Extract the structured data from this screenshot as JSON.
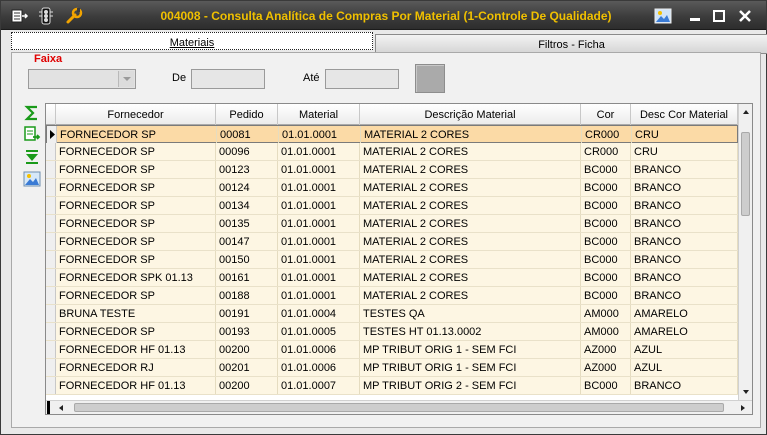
{
  "window": {
    "title": "004008 - Consulta Analítica de Compras Por Material (1-Controle De Qualidade)"
  },
  "tabs": [
    {
      "label": "Materiais",
      "active": true
    },
    {
      "label": "Filtros - Ficha",
      "active": false
    }
  ],
  "filter": {
    "faixa_label": "Faixa",
    "faixa_value": "",
    "de_label": "De",
    "de_value": "",
    "ate_label": "Até",
    "ate_value": ""
  },
  "side_tools": [
    "sum-icon",
    "export-icon",
    "download-icon",
    "image-icon"
  ],
  "grid": {
    "columns": [
      "Fornecedor",
      "Pedido",
      "Material",
      "Descrição Material",
      "Cor",
      "Desc Cor Material"
    ],
    "rows": [
      [
        "FORNECEDOR SP",
        "00081",
        "01.01.0001",
        "MATERIAL 2 CORES",
        "CR000",
        "CRU"
      ],
      [
        "FORNECEDOR SP",
        "00096",
        "01.01.0001",
        "MATERIAL 2 CORES",
        "CR000",
        "CRU"
      ],
      [
        "FORNECEDOR SP",
        "00123",
        "01.01.0001",
        "MATERIAL 2 CORES",
        "BC000",
        "BRANCO"
      ],
      [
        "FORNECEDOR SP",
        "00124",
        "01.01.0001",
        "MATERIAL 2 CORES",
        "BC000",
        "BRANCO"
      ],
      [
        "FORNECEDOR SP",
        "00134",
        "01.01.0001",
        "MATERIAL 2 CORES",
        "BC000",
        "BRANCO"
      ],
      [
        "FORNECEDOR SP",
        "00135",
        "01.01.0001",
        "MATERIAL 2 CORES",
        "BC000",
        "BRANCO"
      ],
      [
        "FORNECEDOR SP",
        "00147",
        "01.01.0001",
        "MATERIAL 2 CORES",
        "BC000",
        "BRANCO"
      ],
      [
        "FORNECEDOR SP",
        "00150",
        "01.01.0001",
        "MATERIAL 2 CORES",
        "BC000",
        "BRANCO"
      ],
      [
        "FORNECEDOR SPK 01.13",
        "00161",
        "01.01.0001",
        "MATERIAL 2 CORES",
        "BC000",
        "BRANCO"
      ],
      [
        "FORNECEDOR SP",
        "00188",
        "01.01.0001",
        "MATERIAL 2 CORES",
        "BC000",
        "BRANCO"
      ],
      [
        "BRUNA TESTE",
        "00191",
        "01.01.0004",
        "TESTES QA",
        "AM000",
        "AMARELO"
      ],
      [
        "FORNECEDOR SP",
        "00193",
        "01.01.0005",
        "TESTES HT 01.13.0002",
        "AM000",
        "AMARELO"
      ],
      [
        "FORNECEDOR HF 01.13",
        "00200",
        "01.01.0006",
        " MP TRIBUT ORIG 1 - SEM FCI",
        "AZ000",
        "AZUL"
      ],
      [
        "FORNECEDOR RJ",
        "00201",
        "01.01.0006",
        " MP TRIBUT ORIG 1 - SEM FCI",
        "AZ000",
        "AZUL"
      ],
      [
        "FORNECEDOR HF 01.13",
        "00200",
        "01.01.0007",
        " MP TRIBUT ORIG 2 - SEM FCI",
        "BC000",
        "BRANCO"
      ]
    ],
    "selected_row": 0
  },
  "colors": {
    "title_text": "#f0c000",
    "row_bg": "#fdf6e3",
    "selected_row_bg": "#fbdaa6",
    "faixa_label": "#e00000"
  }
}
